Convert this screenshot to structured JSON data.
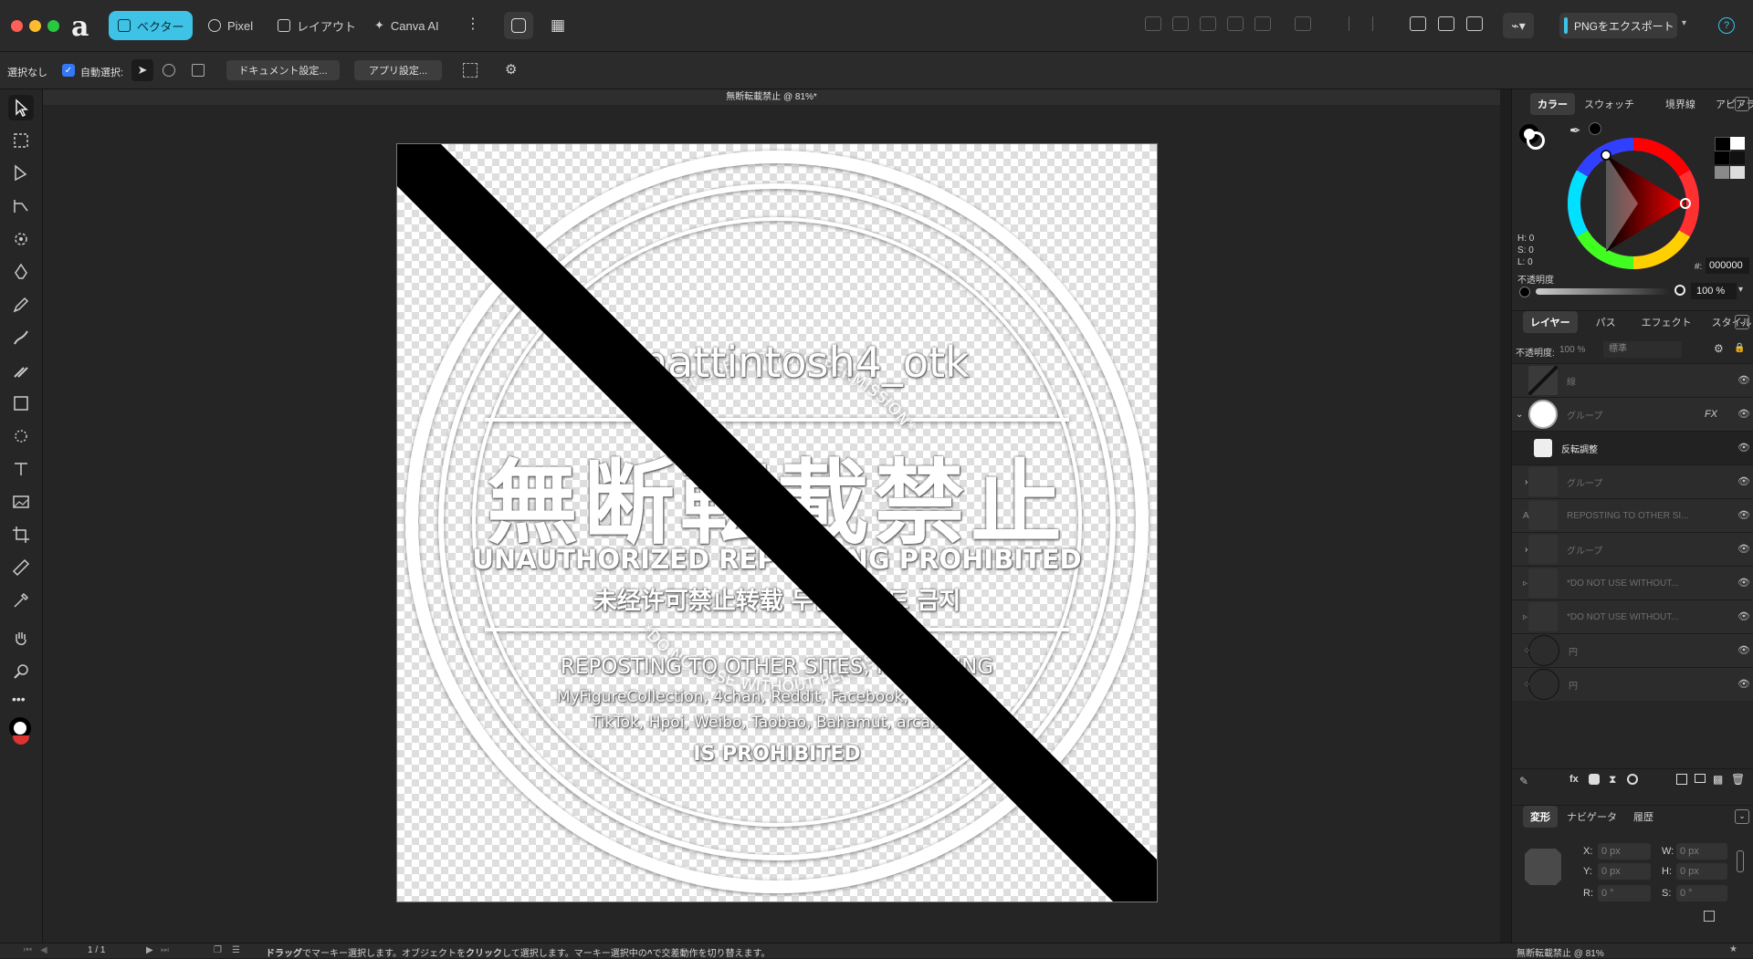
{
  "topbar": {
    "personas": [
      "ベクター",
      "Pixel",
      "レイアウト",
      "Canva AI"
    ],
    "export_label": "PNGをエクスポート",
    "help": "?"
  },
  "context": {
    "selection": "選択なし",
    "auto_select": "自動選択:",
    "doc_settings": "ドキュメント設定...",
    "app_settings": "アプリ設定..."
  },
  "document": {
    "tab_title": "無断転載禁止 @ 81%*",
    "status_title": "無断転載禁止 @ 81%"
  },
  "stamp": {
    "top_arc": "*DO NOT USE WITHOUT PERMISSION*",
    "bottom_arc": "*DO NOT USE WITHOUT PERMISSION*",
    "handle": "@mattintosh4_otk",
    "title_jp": "無断転載禁止",
    "title_en": "UNAUTHORIZED REPOSTING PROHIBITED",
    "title_cjk": "未经许可禁止转载 무단 업로드 금지",
    "line1": "REPOSTING TO OTHER SITES, INCLUDING",
    "line2": "MyFigureCollection, 4chan, Reddit, Facebook, Instagram,",
    "line3": "TikTok, Hpoi, Weibo, Taobao, Bahamut, arca.live",
    "line4": "IS PROHIBITED"
  },
  "color_panel": {
    "tabs": [
      "カラー",
      "スウォッチ",
      "境界線",
      "アピアラ"
    ],
    "h": "H: 0",
    "s": "S: 0",
    "l": "L: 0",
    "hex_label": "#:",
    "hex": "000000",
    "opacity_label": "不透明度",
    "opacity": "100 %"
  },
  "layers_panel": {
    "tabs": [
      "レイヤー",
      "パス",
      "エフェクト",
      "スタイル"
    ],
    "opacity_label": "不透明度:",
    "opacity": "100 %",
    "blend": "標準",
    "layers": [
      {
        "name": "線"
      },
      {
        "name": "グループ",
        "fx": "FX"
      },
      {
        "name": "反転調整"
      },
      {
        "name": "グループ"
      },
      {
        "name": "REPOSTING TO OTHER SI..."
      },
      {
        "name": "グループ"
      },
      {
        "name": "*DO NOT USE WITHOUT..."
      },
      {
        "name": "*DO NOT USE WITHOUT..."
      },
      {
        "name": "円"
      },
      {
        "name": "円"
      }
    ]
  },
  "transform_panel": {
    "tabs": [
      "変形",
      "ナビゲータ",
      "履歴"
    ],
    "x_label": "X:",
    "x": "0 px",
    "y_label": "Y:",
    "y": "0 px",
    "w_label": "W:",
    "w": "0 px",
    "h_label": "H:",
    "h": "0 px",
    "r_label": "R:",
    "r": "0 °",
    "s_label": "S:",
    "s": "0 °"
  },
  "statusbar": {
    "page": "1 / 1",
    "hint_a": "ドラッグ",
    "hint_b": "でマーキー選択します。オブジェクトを",
    "hint_c": "クリック",
    "hint_d": "して選択します。マーキー選択中の",
    "hint_e": "^",
    "hint_f": "で交差動作を切り替えます。"
  },
  "colors": {
    "accent": "#3ec2e6",
    "checkbox": "#3478f6",
    "panel_bg": "#262626"
  }
}
